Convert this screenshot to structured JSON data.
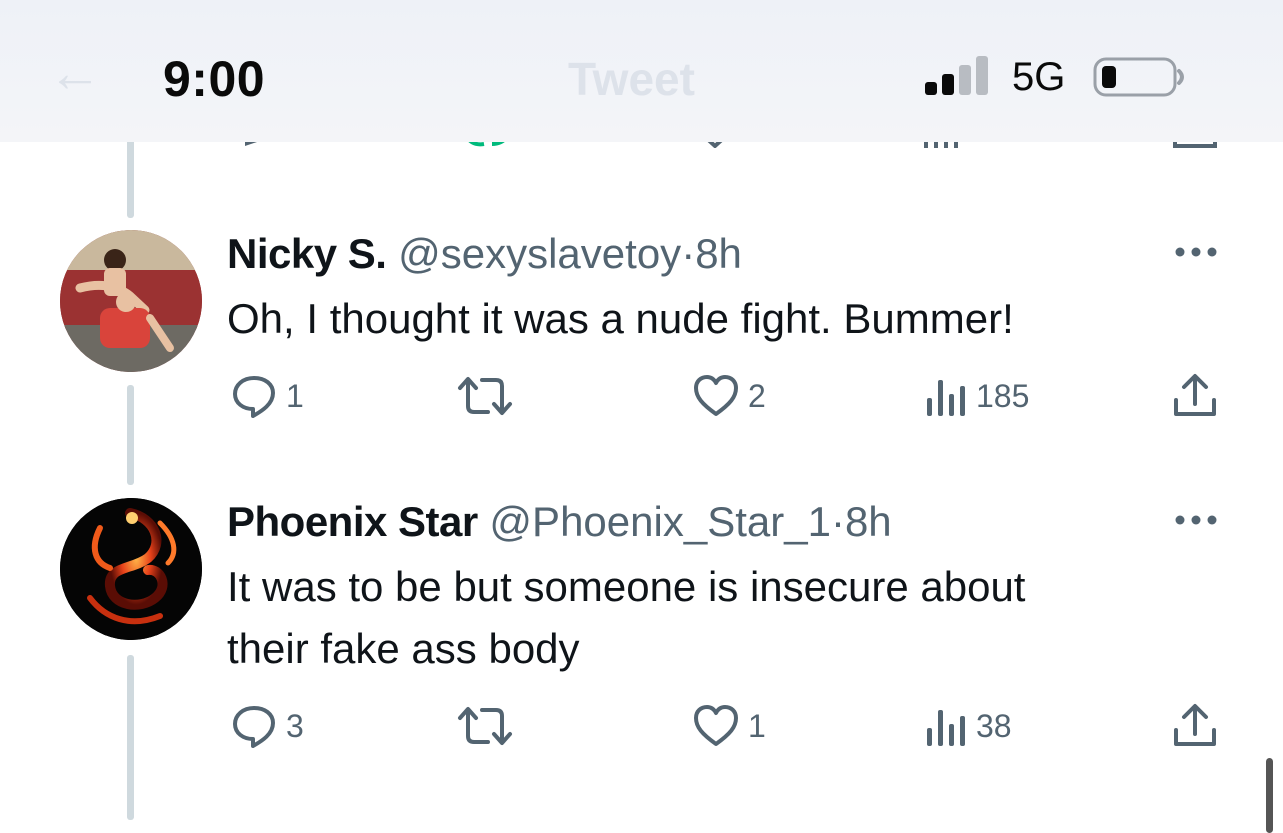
{
  "status_bar": {
    "time": "9:00",
    "network": "5G"
  },
  "nav": {
    "back_glyph": "←",
    "title": "Tweet"
  },
  "tweets": [
    {
      "display_name": "Nicky S.",
      "handle": "@sexyslavetoy",
      "separator": "·",
      "time": "8h",
      "text": "Oh, I thought it was a nude fight.  Bummer!",
      "replies": "1",
      "retweets": "",
      "likes": "2",
      "views": "185",
      "avatar_icon": "person-photo-avatar"
    },
    {
      "display_name": "Phoenix Star",
      "handle": "@Phoenix_Star_1",
      "separator": "·",
      "time": "8h",
      "text_line1": "It was to be but someone is insecure about",
      "text_line2": "their fake ass body",
      "replies": "3",
      "retweets": "",
      "likes": "1",
      "views": "38",
      "avatar_icon": "phoenix-avatar"
    }
  ],
  "colors": {
    "text_primary": "#0f1419",
    "text_secondary": "#536471",
    "thread_line": "#cfd9de",
    "header_bg": "#eef1f7"
  }
}
